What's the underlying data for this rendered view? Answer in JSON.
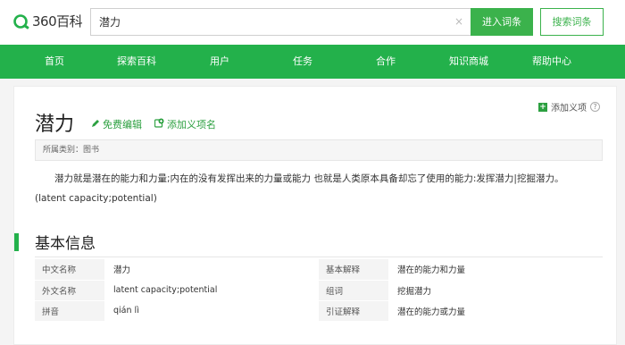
{
  "header": {
    "logo_text": "360百科",
    "search_value": "潜力",
    "clear_icon": "×",
    "enter_button": "进入词条",
    "search_button": "搜索词条"
  },
  "nav": {
    "items": [
      "首页",
      "探索百科",
      "用户",
      "任务",
      "合作",
      "知识商城",
      "帮助中心"
    ]
  },
  "entry": {
    "title": "潜力",
    "edit_label": "免费编辑",
    "add_sense_label": "添加义项名",
    "add_meaning_label": "添加义项",
    "category_label": "所属类别：图书",
    "summary_line1": "潜力就是潜在的能力和力量;内在的没有发挥出来的力量或能力 也就是人类原本具备却忘了使用的能力:发挥潜力|挖掘潜力。",
    "summary_line2": "(latent capacity;potential)"
  },
  "basic_info": {
    "section_title": "基本信息",
    "rows": [
      {
        "k1": "中文名称",
        "v1": "潜力",
        "k2": "基本解释",
        "v2": "潜在的能力和力量"
      },
      {
        "k1": "外文名称",
        "v1": "latent capacity;potential",
        "k2": "组词",
        "v2": "挖掘潜力"
      },
      {
        "k1": "拼音",
        "v1": "qián lì",
        "k2": "引证解释",
        "v2": "潜在的能力或力量"
      }
    ]
  },
  "colors": {
    "brand_green": "#23b14b",
    "button_green": "#3bb24c"
  }
}
